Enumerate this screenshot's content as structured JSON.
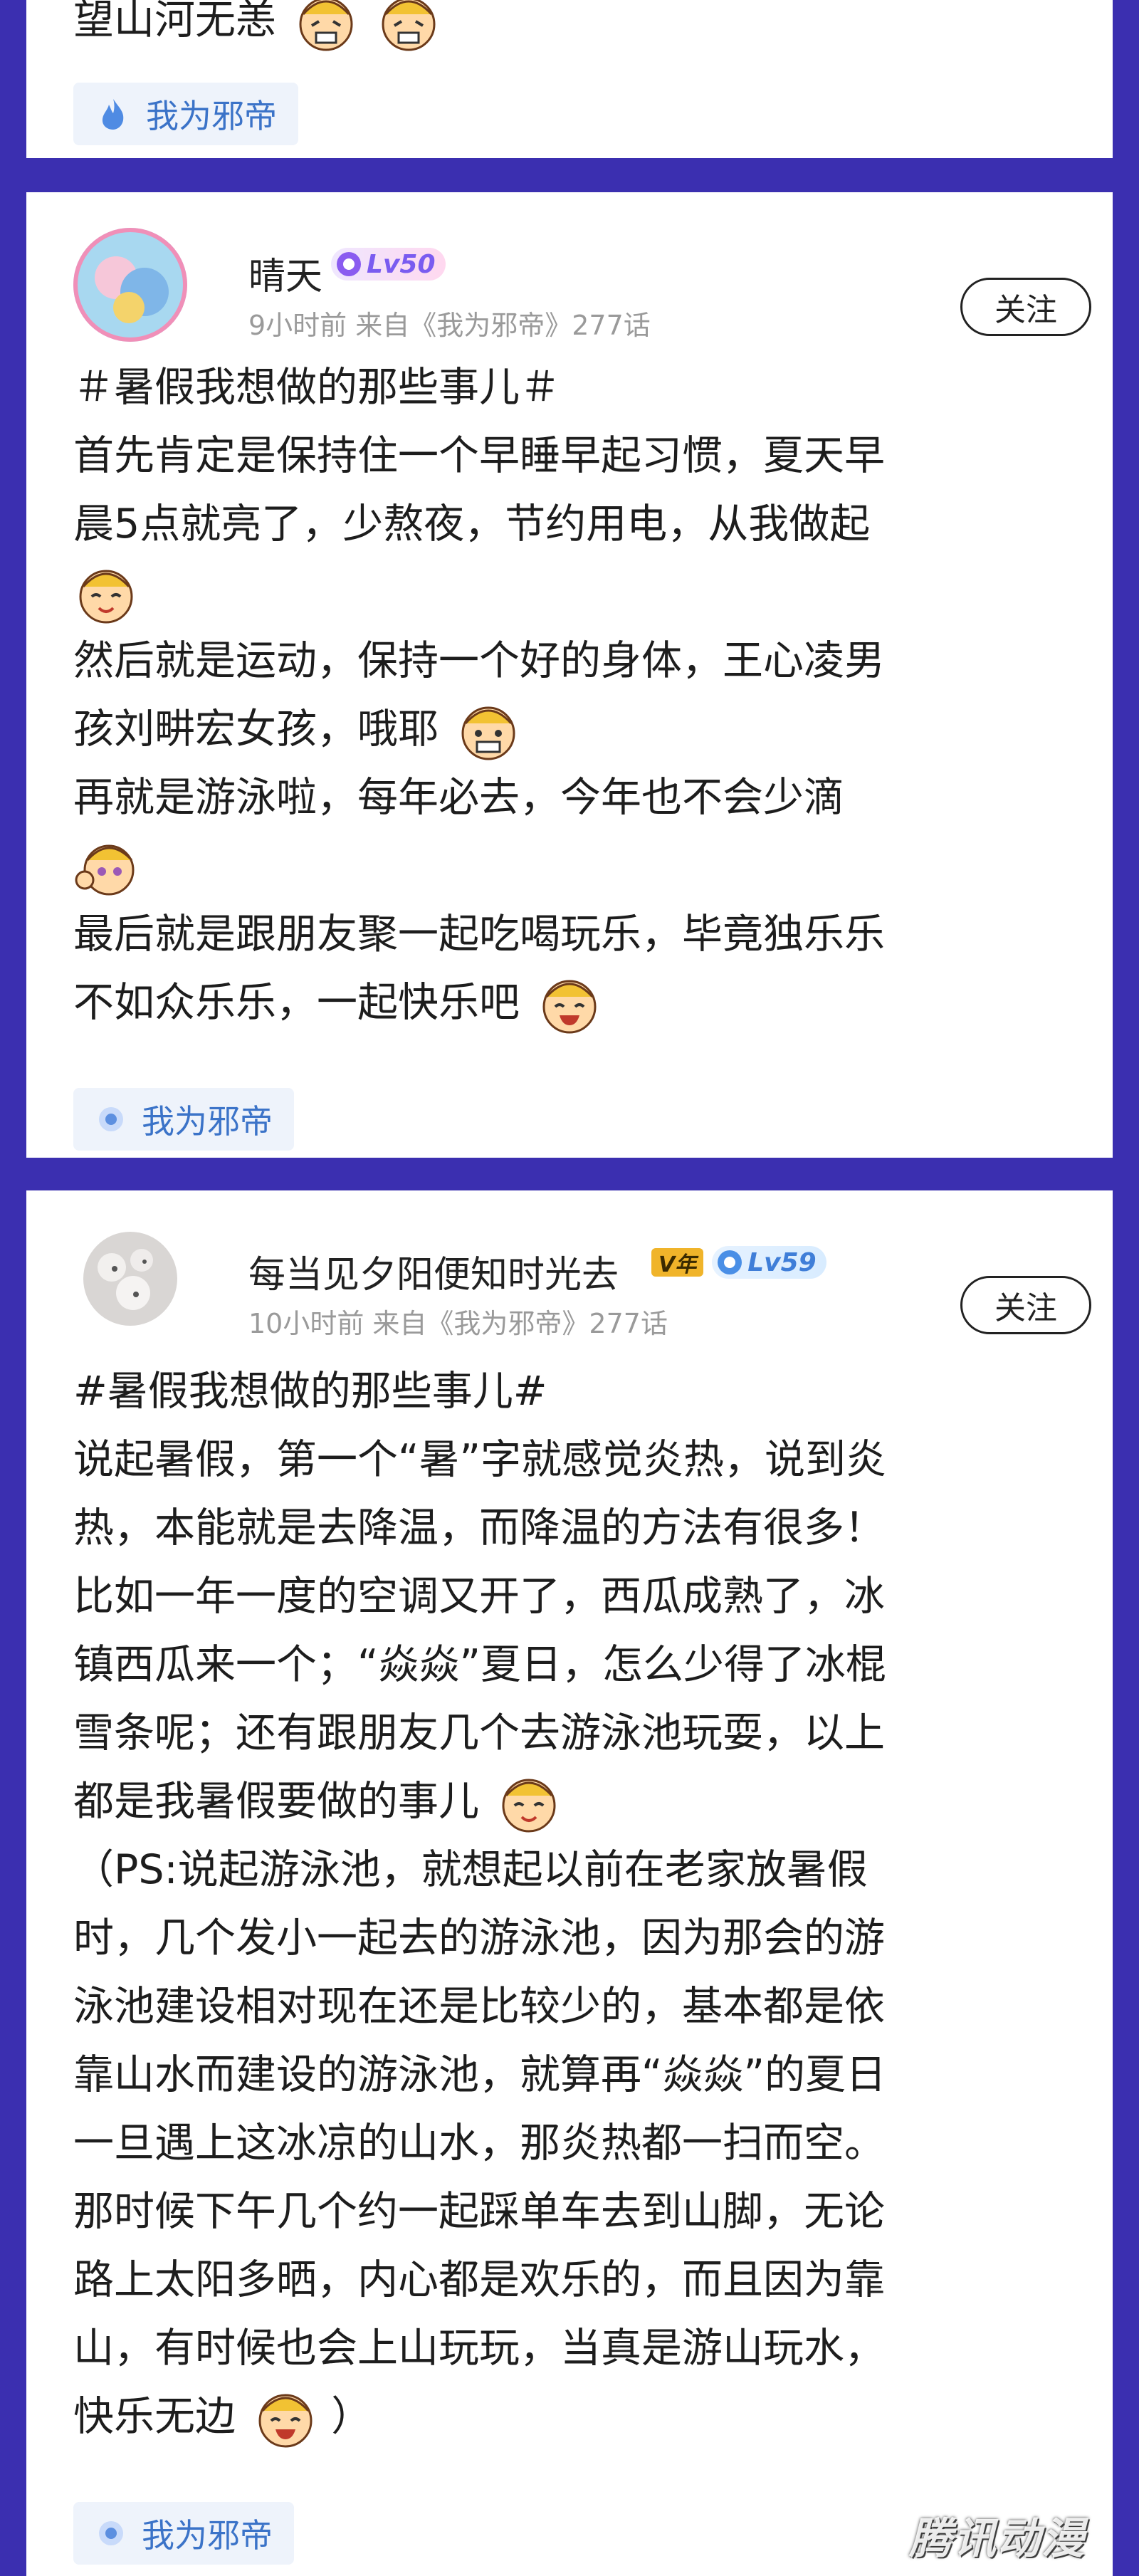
{
  "posts": [
    {
      "lines": [
        "望山河无恙"
      ],
      "tag": "我为邪帝"
    },
    {
      "username": "晴天",
      "level": "Lv50",
      "meta": "9小时前 来自《我为邪帝》277话",
      "follow_label": "关注",
      "lines": [
        "＃暑假我想做的那些事儿＃",
        "首先肯定是保持住一个早睡早起习惯，夏天早",
        "晨5点就亮了，少熬夜，节约用电，从我做起",
        "",
        "然后就是运动，保持一个好的身体，王心凌男",
        "孩刘畊宏女孩，哦耶",
        "再就是游泳啦，每年必去，今年也不会少滴",
        "",
        "最后就是跟朋友聚一起吃喝玩乐，毕竟独乐乐",
        "不如众乐乐，一起快乐吧"
      ],
      "tag": "我为邪帝"
    },
    {
      "username": "每当见夕阳便知时光去",
      "vip": "V年",
      "level": "Lv59",
      "meta": "10小时前 来自《我为邪帝》277话",
      "follow_label": "关注",
      "lines": [
        "#暑假我想做的那些事儿#",
        "说起暑假，第一个“暑”字就感觉炎热，说到炎",
        "热，本能就是去降温，而降温的方法有很多！",
        "比如一年一度的空调又开了，西瓜成熟了，冰",
        "镇西瓜来一个；“焱焱”夏日，怎么少得了冰棍",
        "雪条呢；还有跟朋友几个去游泳池玩耍，以上",
        "都是我暑假要做的事儿",
        "（PS:说起游泳池，就想起以前在老家放暑假",
        "时，几个发小一起去的游泳池，因为那会的游",
        "泳池建设相对现在还是比较少的，基本都是依",
        "靠山水而建设的游泳池，就算再“焱焱”的夏日",
        "一旦遇上这冰凉的山水，那炎热都一扫而空。",
        "那时候下午几个约一起踩单车去到山脚，无论",
        "路上太阳多晒，内心都是欢乐的，而且因为靠",
        "山，有时候也会上山玩玩，当真是游山玩水，",
        "快乐无边",
        "）"
      ],
      "tag": "我为邪帝"
    }
  ],
  "watermark": "腾讯动漫",
  "colors": {
    "background": "#3b2fb0",
    "tag_text": "#3b73c8",
    "tag_bg": "#eef3fb"
  }
}
